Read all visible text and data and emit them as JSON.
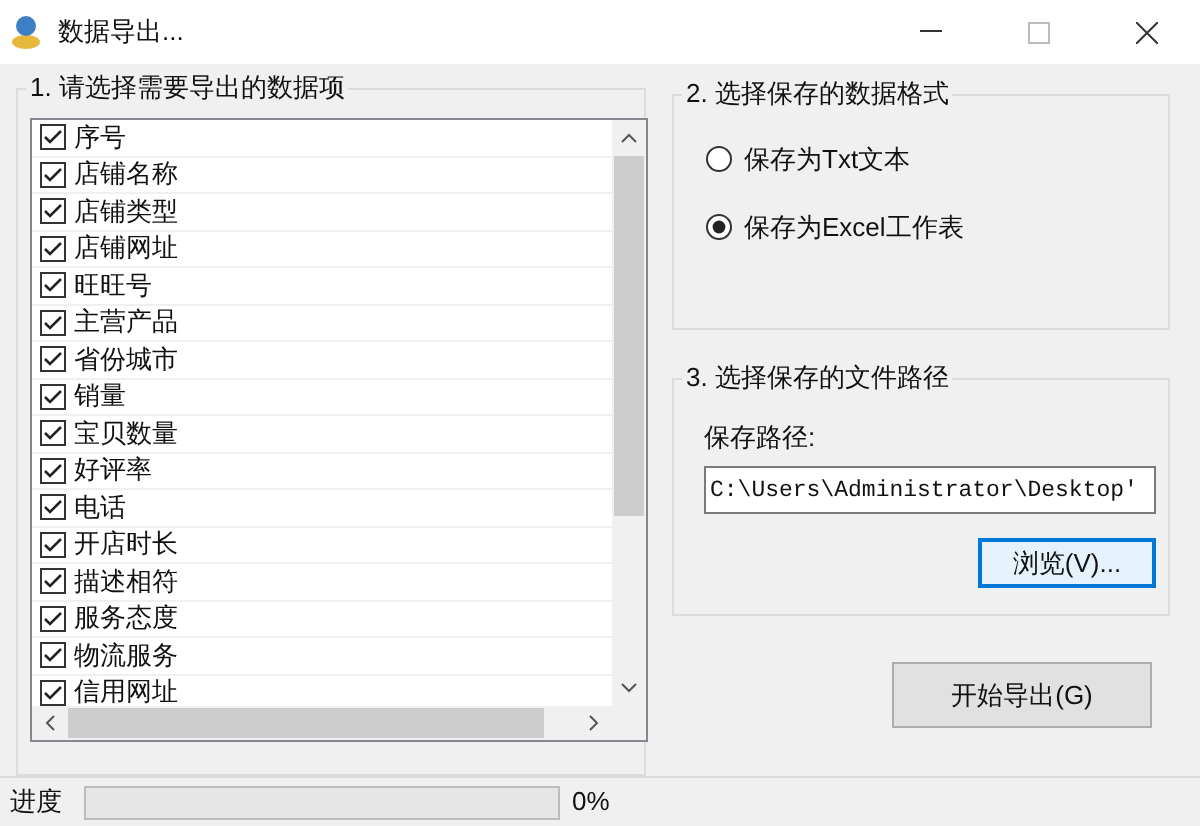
{
  "window": {
    "title": "数据导出..."
  },
  "fields_group": {
    "title": "1. 请选择需要导出的数据项",
    "items": [
      {
        "label": "序号",
        "checked": true
      },
      {
        "label": "店铺名称",
        "checked": true
      },
      {
        "label": "店铺类型",
        "checked": true
      },
      {
        "label": "店铺网址",
        "checked": true
      },
      {
        "label": "旺旺号",
        "checked": true
      },
      {
        "label": "主营产品",
        "checked": true
      },
      {
        "label": "省份城市",
        "checked": true
      },
      {
        "label": "销量",
        "checked": true
      },
      {
        "label": "宝贝数量",
        "checked": true
      },
      {
        "label": "好评率",
        "checked": true
      },
      {
        "label": "电话",
        "checked": true
      },
      {
        "label": "开店时长",
        "checked": true
      },
      {
        "label": "描述相符",
        "checked": true
      },
      {
        "label": "服务态度",
        "checked": true
      },
      {
        "label": "物流服务",
        "checked": true
      },
      {
        "label": "信用网址",
        "checked": true
      }
    ]
  },
  "format_group": {
    "title": "2. 选择保存的数据格式",
    "options": [
      {
        "label": "保存为Txt文本",
        "selected": false
      },
      {
        "label": "保存为Excel工作表",
        "selected": true
      }
    ]
  },
  "path_group": {
    "title": "3. 选择保存的文件路径",
    "label": "保存路径:",
    "value": "C:\\Users\\Administrator\\Desktop'",
    "browse_button": "浏览(V)..."
  },
  "start_button": "开始导出(G)",
  "status_bar": {
    "label": "进度",
    "level": 0,
    "reading": "0%"
  }
}
